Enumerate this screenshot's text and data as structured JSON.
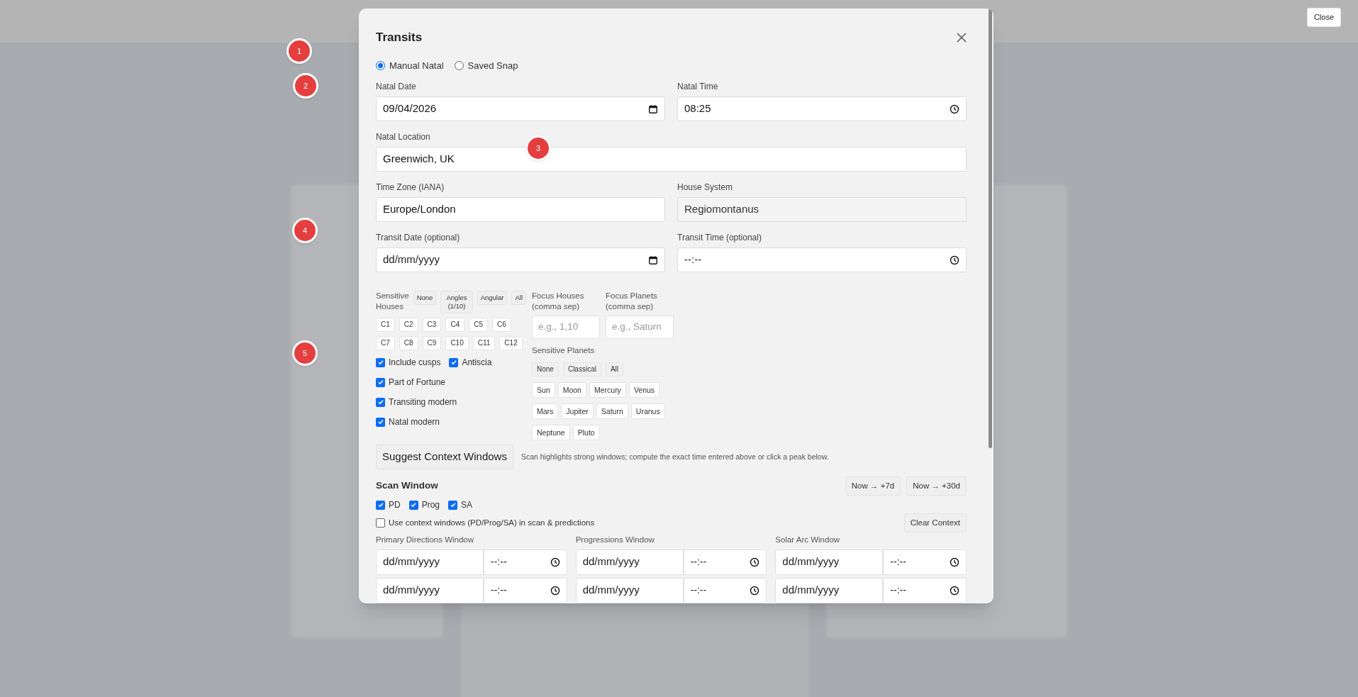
{
  "annotations": [
    {
      "label": "1"
    },
    {
      "label": "2"
    },
    {
      "label": "3"
    },
    {
      "label": "4"
    },
    {
      "label": "5"
    }
  ],
  "close_button": "Close",
  "dialog": {
    "title": "Transits",
    "source_options": [
      {
        "label": "Manual Natal",
        "selected": true
      },
      {
        "label": "Saved Snap",
        "selected": false
      }
    ],
    "field_rows": [
      [
        {
          "label": "Natal Date",
          "kind": "date",
          "value": "09/04/2026"
        },
        {
          "label": "Natal Time",
          "kind": "time",
          "value": "08:25"
        }
      ],
      [
        {
          "label": "Natal Location",
          "kind": "text",
          "value": "Greenwich, UK"
        }
      ],
      [
        {
          "label": "Time Zone (IANA)",
          "kind": "text",
          "value": "Europe/London"
        },
        {
          "label": "House System",
          "kind": "readonly",
          "value": "Regiomontanus"
        }
      ],
      [
        {
          "label": "Transit Date (optional)",
          "kind": "date",
          "placeholder": "dd/mm/yyyy"
        },
        {
          "label": "Transit Time (optional)",
          "kind": "time",
          "placeholder": "--:--"
        }
      ]
    ],
    "sensitive_houses": {
      "label": "Sensitive Houses",
      "presets": [
        "None",
        "Angles (1/10)",
        "Angular",
        "All"
      ],
      "houses": [
        [
          "C1",
          "C2",
          "C3",
          "C4",
          "C5",
          "C6"
        ],
        [
          "C7",
          "C8",
          "C9",
          "C10",
          "C11",
          "C12"
        ]
      ]
    },
    "option_rows": [
      [
        {
          "label": "Include cusps",
          "checked": true
        },
        {
          "label": "Antiscia",
          "checked": true
        }
      ],
      [
        {
          "label": "Part of Fortune",
          "checked": true
        }
      ],
      [
        {
          "label": "Transiting modern",
          "checked": true
        }
      ],
      [
        {
          "label": "Natal modern",
          "checked": true
        }
      ]
    ],
    "focus_fields": [
      {
        "label": "Focus Houses (comma sep)",
        "placeholder": "e.g., 1,10"
      },
      {
        "label": "Focus Planets (comma sep)",
        "placeholder": "e.g., Saturn"
      }
    ],
    "sensitive_planets": {
      "label": "Sensitive Planets",
      "presets": [
        "None",
        "Classical",
        "All"
      ],
      "planets": [
        [
          "Sun",
          "Moon",
          "Mercury",
          "Venus"
        ],
        [
          "Mars",
          "Jupiter",
          "Saturn",
          "Uranus"
        ],
        [
          "Neptune",
          "Pluto"
        ]
      ]
    },
    "suggest_button": "Suggest Context Windows",
    "hint": "Scan highlights strong windows; compute the exact time entered above or click a peak below.",
    "scan_window": {
      "title": "Scan Window",
      "range_buttons": [
        "Now → +7d",
        "Now → +30d"
      ],
      "methods": [
        {
          "label": "PD",
          "checked": true
        },
        {
          "label": "Prog",
          "checked": true
        },
        {
          "label": "SA",
          "checked": true
        }
      ],
      "context": {
        "label": "Use context windows (PD/Prog/SA) in scan & predictions",
        "checked": false
      },
      "clear_button": "Clear Context",
      "windows": [
        {
          "label": "Primary Directions Window",
          "rows": [
            {
              "date_placeholder": "dd/mm/yyyy",
              "time_placeholder": "--:--"
            },
            {
              "date_placeholder": "dd/mm/yyyy",
              "time_placeholder": "--:--"
            }
          ]
        },
        {
          "label": "Progressions Window",
          "rows": [
            {
              "date_placeholder": "dd/mm/yyyy",
              "time_placeholder": "--:--"
            },
            {
              "date_placeholder": "dd/mm/yyyy",
              "time_placeholder": "--:--"
            }
          ]
        },
        {
          "label": "Solar Arc Window",
          "rows": [
            {
              "date_placeholder": "dd/mm/yyyy",
              "time_placeholder": "--:--"
            },
            {
              "date_placeholder": "dd/mm/yyyy",
              "time_placeholder": "--:--"
            }
          ]
        }
      ]
    }
  }
}
